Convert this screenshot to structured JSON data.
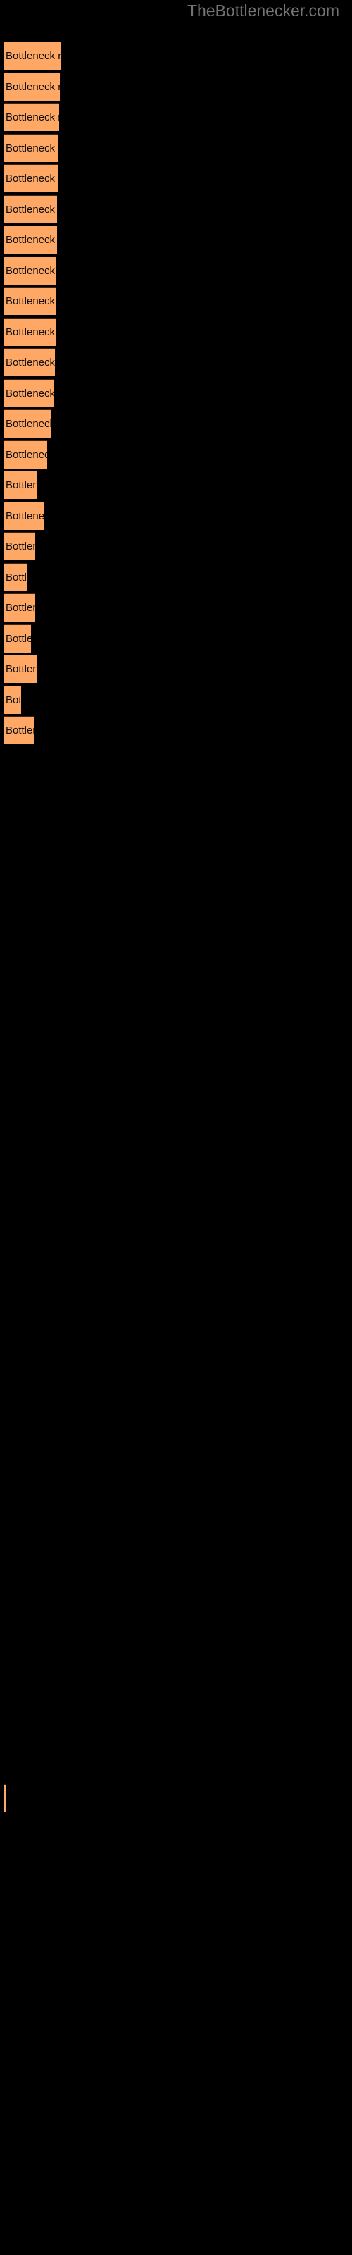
{
  "site": {
    "watermark": "TheBottlenecker.com"
  },
  "chart_data": {
    "type": "bar",
    "orientation": "horizontal",
    "title": "TheBottlenecker.com",
    "xlabel": "",
    "ylabel": "",
    "grid": false,
    "legend_position": "bottom-left",
    "bar_color": "#ffa866",
    "bar_edge_color": "#3d2313",
    "background_color": "#000000",
    "title_color": "#737373",
    "label_color": "#0d0d0d",
    "bar_label_text": "Bottleneck result",
    "categories": [
      "Bottleneck result",
      "Bottleneck result",
      "Bottleneck result",
      "Bottleneck result",
      "Bottleneck result",
      "Bottleneck result",
      "Bottleneck result",
      "Bottleneck result",
      "Bottleneck result",
      "Bottleneck result",
      "Bottleneck result",
      "Bottleneck result",
      "Bottleneck result",
      "Bottleneck result",
      "Bottleneck result",
      "Bottleneck result",
      "Bottleneck result",
      "Bottleneck result",
      "Bottleneck result",
      "Bottleneck result",
      "Bottleneck result",
      "Bottleneck result"
    ],
    "values": [
      82,
      80,
      79,
      78,
      77,
      76,
      76,
      75,
      75,
      74,
      73,
      71,
      68,
      62,
      48,
      58,
      45,
      34,
      45,
      39,
      48,
      25,
      43
    ],
    "xlim": [
      0,
      500
    ],
    "bar_pixel_widths": [
      82,
      80,
      79,
      78,
      77,
      76,
      76,
      75,
      75,
      74,
      73,
      71,
      68,
      62,
      48,
      58,
      45,
      34,
      45,
      39,
      48,
      25,
      43
    ],
    "legend": [
      {
        "label": "",
        "color": "#ffa866"
      }
    ]
  },
  "bars": [
    {
      "label": "Bottleneck result",
      "width": 82,
      "top": 59
    },
    {
      "label": "Bottleneck result",
      "width": 80,
      "top": 103
    },
    {
      "label": "Bottleneck result",
      "width": 79,
      "top": 146
    },
    {
      "label": "Bottleneck result",
      "width": 78,
      "top": 190
    },
    {
      "label": "Bottleneck result",
      "width": 77,
      "top": 233
    },
    {
      "label": "Bottleneck result",
      "width": 76,
      "top": 277
    },
    {
      "label": "Bottleneck result",
      "width": 76,
      "top": 320
    },
    {
      "label": "Bottleneck result",
      "width": 75,
      "top": 364
    },
    {
      "label": "Bottleneck result",
      "width": 75,
      "top": 407
    },
    {
      "label": "Bottleneck result",
      "width": 74,
      "top": 451
    },
    {
      "label": "Bottleneck result",
      "width": 73,
      "top": 494
    },
    {
      "label": "Bottleneck result",
      "width": 71,
      "top": 538
    },
    {
      "label": "Bottleneck result",
      "width": 68,
      "top": 581
    },
    {
      "label": "Bottleneck result",
      "width": 62,
      "top": 625
    },
    {
      "label": "Bottleneck result",
      "width": 48,
      "top": 668
    },
    {
      "label": "Bottleneck result",
      "width": 58,
      "top": 712
    },
    {
      "label": "Bottleneck result",
      "width": 45,
      "top": 755
    },
    {
      "label": "Bottleneck result",
      "width": 34,
      "top": 799
    },
    {
      "label": "Bottleneck result",
      "width": 45,
      "top": 842
    },
    {
      "label": "Bottleneck result",
      "width": 39,
      "top": 886
    },
    {
      "label": "Bottleneck result",
      "width": 48,
      "top": 929
    },
    {
      "label": "Bottleneck result",
      "width": 25,
      "top": 973
    },
    {
      "label": "Bottleneck result",
      "width": 43,
      "top": 1016
    }
  ],
  "legend": {
    "label": "",
    "color": "#ffa866"
  }
}
